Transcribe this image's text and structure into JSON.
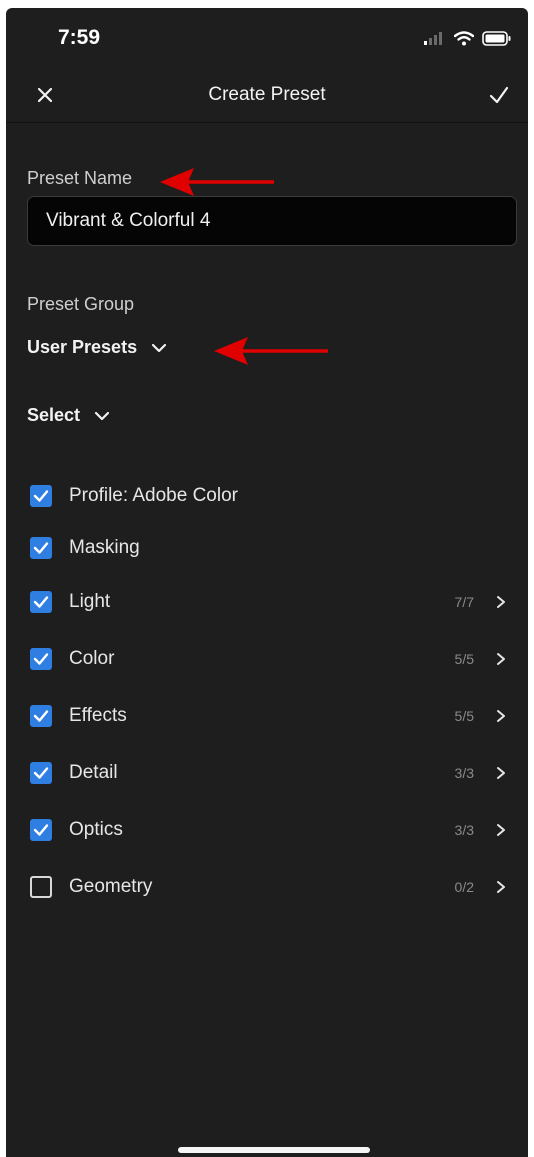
{
  "status": {
    "time": "7:59"
  },
  "nav": {
    "title": "Create Preset"
  },
  "preset_name": {
    "label": "Preset Name",
    "value": "Vibrant & Colorful 4"
  },
  "preset_group": {
    "label": "Preset Group",
    "selected": "User Presets"
  },
  "select_label": "Select",
  "items": [
    {
      "label": "Profile: Adobe Color",
      "checked": true,
      "count": ""
    },
    {
      "label": "Masking",
      "checked": true,
      "count": ""
    },
    {
      "label": "Light",
      "checked": true,
      "count": "7/7"
    },
    {
      "label": "Color",
      "checked": true,
      "count": "5/5"
    },
    {
      "label": "Effects",
      "checked": true,
      "count": "5/5"
    },
    {
      "label": "Detail",
      "checked": true,
      "count": "3/3"
    },
    {
      "label": "Optics",
      "checked": true,
      "count": "3/3"
    },
    {
      "label": "Geometry",
      "checked": false,
      "count": "0/2"
    }
  ],
  "colors": {
    "accent": "#2f7fe3",
    "annotation_arrow": "#e00000",
    "background": "#1e1e1e"
  }
}
